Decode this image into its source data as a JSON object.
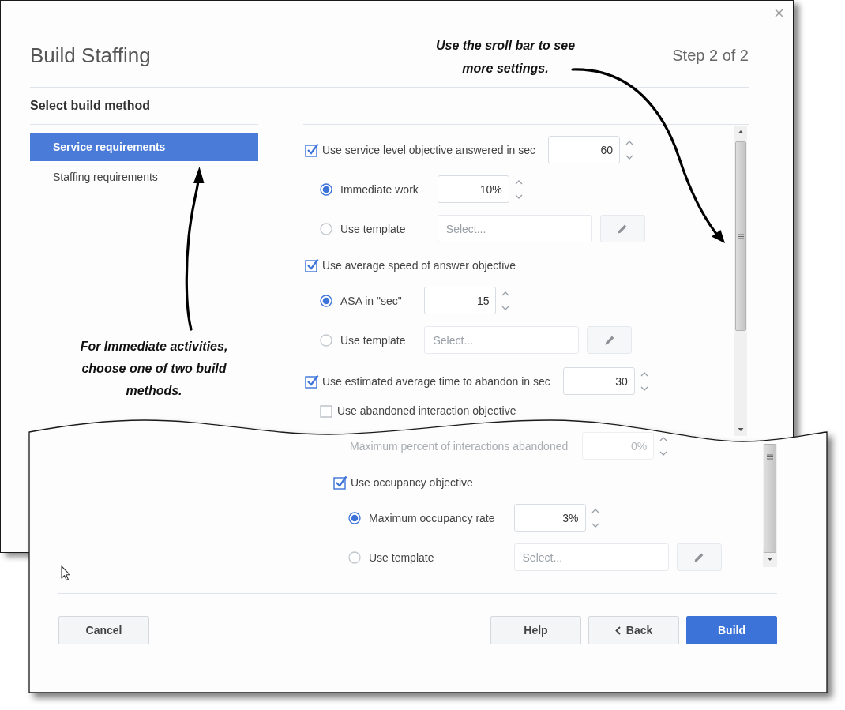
{
  "dialog": {
    "title": "Build Staffing",
    "step": "Step 2 of 2"
  },
  "sidebar": {
    "heading": "Select build method",
    "items": [
      {
        "label": "Service requirements",
        "selected": true
      },
      {
        "label": "Staffing requirements",
        "selected": false
      }
    ]
  },
  "form_upper": [
    {
      "kind": "checkbox",
      "label": "Use service level objective answered in sec",
      "checked": true,
      "value": "60",
      "children": [
        {
          "kind": "radio",
          "label": "Immediate work",
          "selected": true,
          "value": "10%"
        },
        {
          "kind": "radio",
          "label": "Use template",
          "selected": false,
          "placeholder": "Select..."
        }
      ]
    },
    {
      "kind": "checkbox",
      "label": "Use average speed of answer objective",
      "checked": true,
      "children": [
        {
          "kind": "radio",
          "label": "ASA in \"sec\"",
          "selected": true,
          "value": "15"
        },
        {
          "kind": "radio",
          "label": "Use template",
          "selected": false,
          "placeholder": "Select..."
        }
      ]
    },
    {
      "kind": "checkbox",
      "label": "Use estimated average time to abandon in sec",
      "checked": true,
      "value": "30",
      "children": [
        {
          "kind": "checkbox",
          "label": "Use abandoned interaction objective",
          "checked": false
        }
      ]
    }
  ],
  "form_lower": [
    {
      "kind": "number",
      "label": "Maximum percent of interactions abandoned",
      "value": "0%",
      "disabled": true
    },
    {
      "kind": "checkbox",
      "label": "Use occupancy objective",
      "checked": true,
      "children": [
        {
          "kind": "radio",
          "label": "Maximum occupancy rate",
          "selected": true,
          "value": "3%"
        },
        {
          "kind": "radio",
          "label": "Use template",
          "selected": false,
          "placeholder": "Select..."
        }
      ]
    }
  ],
  "footer": {
    "left_buttons": [
      {
        "label": "Cancel",
        "kind": "plain"
      }
    ],
    "right_buttons": [
      {
        "label": "Help",
        "kind": "plain"
      },
      {
        "label": "Back",
        "kind": "back"
      },
      {
        "label": "Build",
        "kind": "primary"
      }
    ]
  },
  "annotations": [
    {
      "text": "Use the sroll bar to see\nmore settings."
    },
    {
      "text": "For Immediate activities,\nchoose one of two build\nmethods."
    }
  ]
}
